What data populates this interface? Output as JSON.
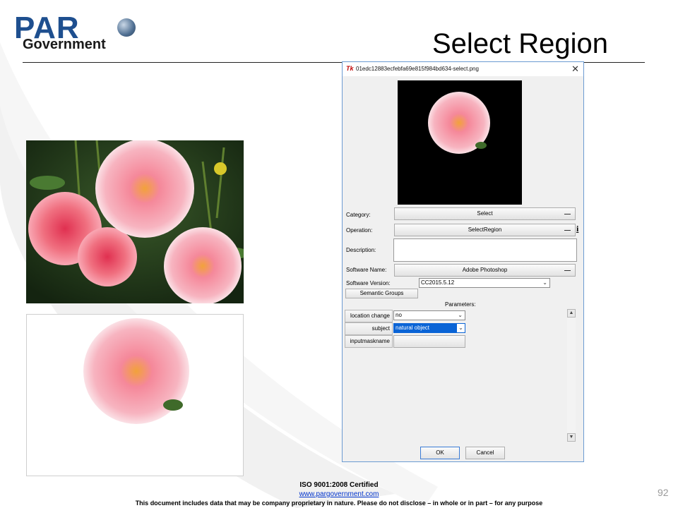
{
  "logo": {
    "par_text": "PAR",
    "gov_text": "Government"
  },
  "slide": {
    "title": "Select Region",
    "page_number": "92"
  },
  "dialog": {
    "window_title": "01edc12883ecfebfa69e815f984bd634-select.png",
    "tk_icon": "Tk",
    "close_glyph": "✕",
    "category_label": "Category:",
    "category_value": "Select",
    "operation_label": "Operation:",
    "operation_value": "SelectRegion",
    "info_icon": "i",
    "description_label": "Description:",
    "software_name_label": "Software Name:",
    "software_name_value": "Adobe Photoshop",
    "software_version_label": "Software Version:",
    "software_version_value": "CC2015.5.12",
    "semantic_groups_label": "Semantic Groups",
    "parameters_label": "Parameters:",
    "parameters": [
      {
        "name": "location change",
        "value": "no"
      },
      {
        "name": "subject",
        "value": "natural object"
      },
      {
        "name": "inputmaskname",
        "value": ""
      }
    ],
    "ok_label": "OK",
    "cancel_label": "Cancel"
  },
  "footer": {
    "iso": "ISO 9001:2008 Certified",
    "url": "www.pargovernment.com",
    "disclaimer": "This document includes data that may be company proprietary in nature. Please do not disclose – in whole or in part – for any purpose"
  },
  "colors": {
    "brand_blue": "#1e4f8f",
    "dialog_border": "#6c9bd2",
    "selection_blue": "#0a64d6"
  }
}
